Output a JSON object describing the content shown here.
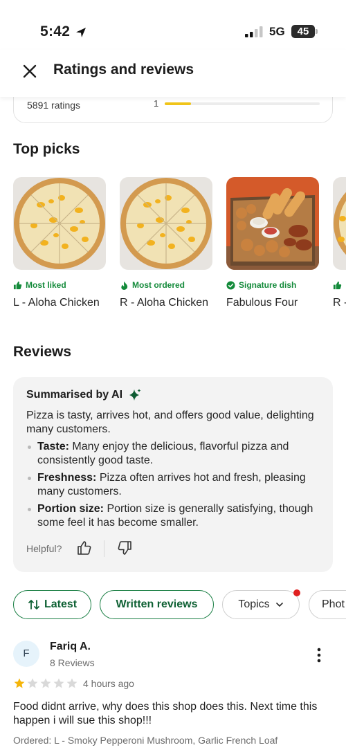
{
  "status_bar": {
    "time": "5:42",
    "network": "5G",
    "battery": "45"
  },
  "header": {
    "title": "Ratings and reviews"
  },
  "ratings_summary": {
    "count_label": "5891 ratings",
    "bar_label": "1",
    "bar_fraction": 0.17
  },
  "top_picks": {
    "title": "Top picks",
    "items": [
      {
        "badge": "Most liked",
        "name": "L - Aloha Chicken",
        "icon": "thumbs-up-icon"
      },
      {
        "badge": "Most ordered",
        "name": "R - Aloha Chicken",
        "icon": "flame-icon"
      },
      {
        "badge": "Signature dish",
        "name": "Fabulous Four",
        "icon": "check-badge-icon"
      },
      {
        "badge": "",
        "name": "R - Ch",
        "icon": "thumbs-up-icon"
      }
    ]
  },
  "reviews": {
    "title": "Reviews",
    "ai_summary": {
      "title": "Summarised by AI",
      "intro": "Pizza is tasty, arrives hot, and offers good value, delighting many customers.",
      "points": [
        {
          "label": "Taste:",
          "text": " Many enjoy the delicious, flavorful pizza and consistently good taste."
        },
        {
          "label": "Freshness:",
          "text": " Pizza often arrives hot and fresh, pleasing many customers."
        },
        {
          "label": "Portion size:",
          "text": " Portion size is generally satisfying, though some feel it has become smaller."
        }
      ],
      "helpful_label": "Helpful?"
    },
    "filters": [
      {
        "label": "Latest",
        "active": true
      },
      {
        "label": "Written reviews",
        "active": true
      },
      {
        "label": "Topics",
        "active": false
      },
      {
        "label": "Phot",
        "active": false
      }
    ],
    "review": {
      "avatar_letter": "F",
      "name": "Fariq A.",
      "meta": "8 Reviews",
      "rating": 1,
      "max_rating": 5,
      "time": "4 hours ago",
      "text": "Food didnt arrive, why does this shop does this. Next time this happen i will sue this shop!!!",
      "ordered": "Ordered: L - Smoky Pepperoni Mushroom, Garlic French Loaf"
    }
  },
  "colors": {
    "brand_green": "#1a7f44",
    "star_gold": "#f5b50a",
    "bar_yellow": "#f0c419"
  }
}
